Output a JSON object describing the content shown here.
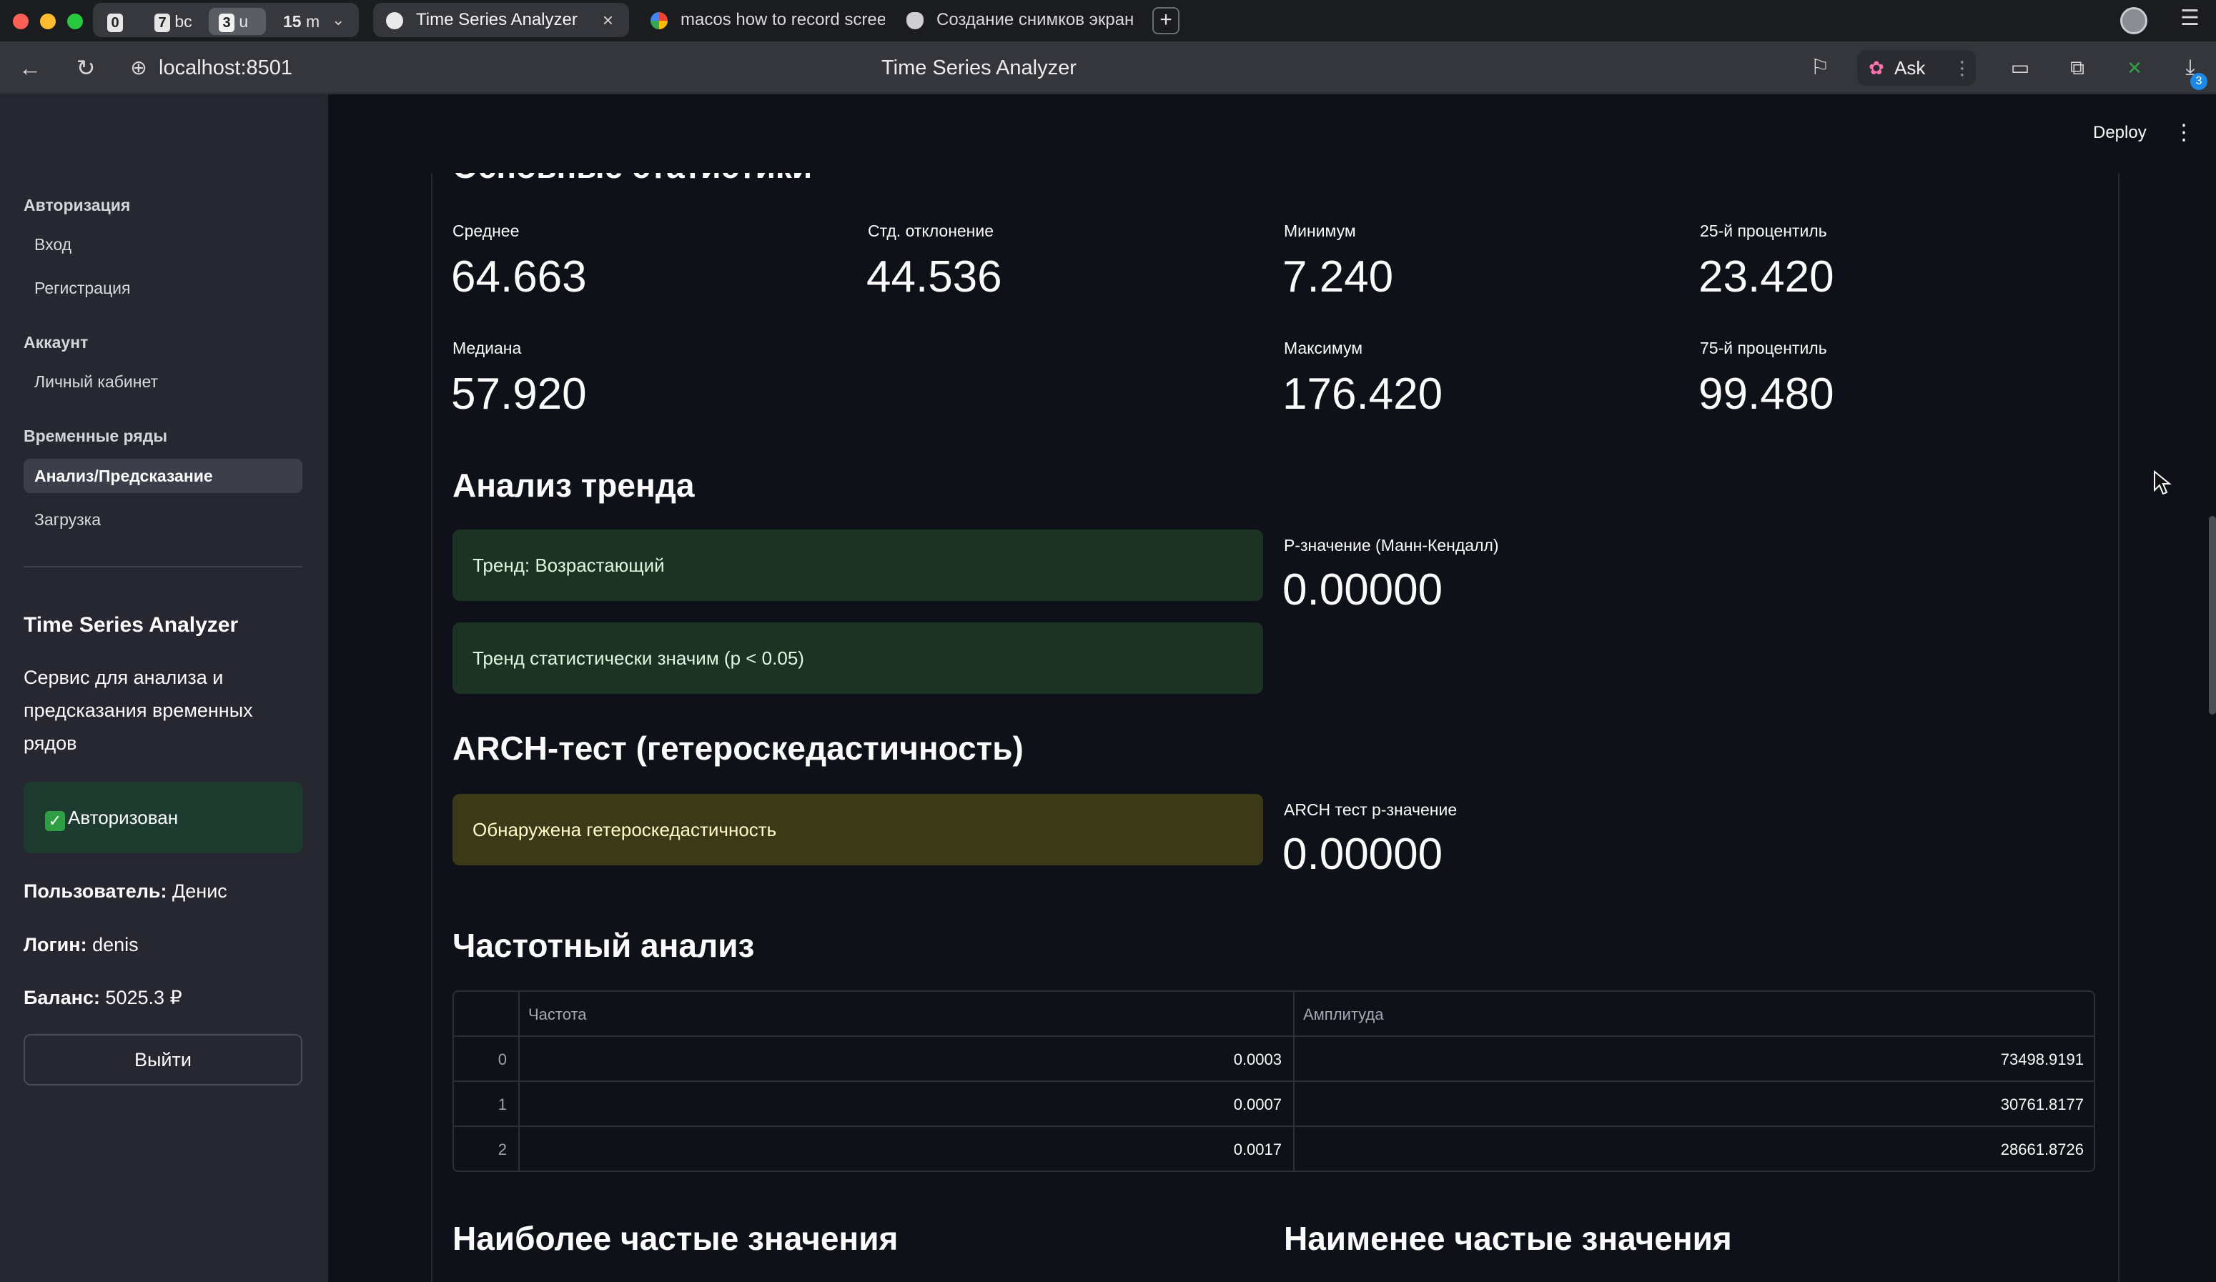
{
  "browser": {
    "tab_groups": [
      {
        "num": "0",
        "label": ""
      },
      {
        "num": "7",
        "label": "bc"
      },
      {
        "num": "3",
        "label": "u"
      },
      {
        "num": "15",
        "label": "m"
      }
    ],
    "tabs": [
      {
        "label": "Time Series Analyzer",
        "close": "×"
      },
      {
        "label": "macos how to record scree"
      },
      {
        "label": "Создание снимков экран"
      }
    ],
    "new_tab": "+",
    "url": "localhost:8501",
    "page_title": "Time Series Analyzer",
    "ask_label": "Ask",
    "download_badge": "3"
  },
  "sidebar": {
    "sections": [
      {
        "title": "Авторизация",
        "items": [
          "Вход",
          "Регистрация"
        ]
      },
      {
        "title": "Аккаунт",
        "items": [
          "Личный кабинет"
        ]
      },
      {
        "title": "Временные ряды",
        "items": [
          "Анализ/Предсказание",
          "Загрузка"
        ]
      }
    ],
    "active_item": "Анализ/Предсказание",
    "app_title": "Time Series Analyzer",
    "app_description": "Сервис для анализа и предсказания временных рядов",
    "auth_status": "Авторизован",
    "user_label": "Пользователь:",
    "user_value": "Денис",
    "login_label": "Логин:",
    "login_value": "denis",
    "balance_label": "Баланс:",
    "balance_value": "5025.3 ₽",
    "logout_label": "Выйти"
  },
  "header": {
    "deploy_label": "Deploy"
  },
  "main": {
    "basic_stats_title": "Основные статистики",
    "metrics": {
      "mean": {
        "label": "Среднее",
        "value": "64.663"
      },
      "std": {
        "label": "Стд. отклонение",
        "value": "44.536"
      },
      "min": {
        "label": "Минимум",
        "value": "7.240"
      },
      "p25": {
        "label": "25-й процентиль",
        "value": "23.420"
      },
      "median": {
        "label": "Медиана",
        "value": "57.920"
      },
      "max": {
        "label": "Максимум",
        "value": "176.420"
      },
      "p75": {
        "label": "75-й процентиль",
        "value": "99.480"
      }
    },
    "trend_title": "Анализ тренда",
    "trend_alert": "Тренд: Возрастающий",
    "trend_sig_alert": "Тренд статистически значим (p < 0.05)",
    "trend_pvalue": {
      "label": "P-значение (Манн-Кендалл)",
      "value": "0.00000"
    },
    "arch_title": "ARCH-тест (гетероскедастичность)",
    "arch_alert": "Обнаружена гетероскедастичность",
    "arch_pvalue": {
      "label": "ARCH тест p-значение",
      "value": "0.00000"
    },
    "freq_title": "Частотный анализ",
    "freq_table": {
      "columns": [
        "Частота",
        "Амплитуда"
      ],
      "rows": [
        {
          "idx": "0",
          "freq": "0.0003",
          "amp": "73498.9191"
        },
        {
          "idx": "1",
          "freq": "0.0007",
          "amp": "30761.8177"
        },
        {
          "idx": "2",
          "freq": "0.0017",
          "amp": "28661.8726"
        }
      ]
    },
    "most_frequent_title": "Наиболее частые значения",
    "least_frequent_title": "Наименее частые значения"
  }
}
